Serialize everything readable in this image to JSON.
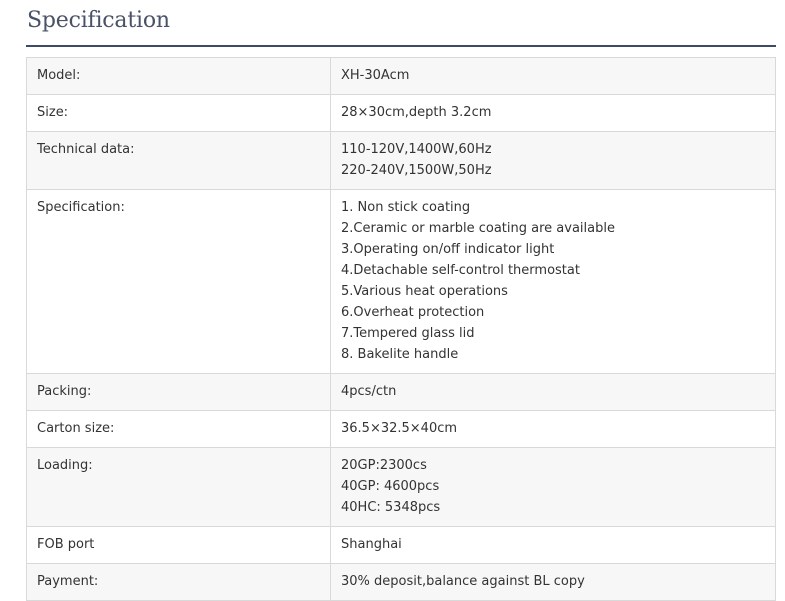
{
  "heading": "Specification",
  "rows": [
    {
      "label": "Model:",
      "lines": [
        "XH-30Acm"
      ]
    },
    {
      "label": "Size:",
      "lines": [
        "28×30cm,depth 3.2cm"
      ]
    },
    {
      "label": "Technical data:",
      "lines": [
        "110-120V,1400W,60Hz",
        "220-240V,1500W,50Hz"
      ]
    },
    {
      "label": "Specification:",
      "lines": [
        "1. Non stick coating",
        "2.Ceramic or marble coating are available",
        "3.Operating on/off indicator light",
        "4.Detachable self-control thermostat",
        "5.Various heat operations",
        "6.Overheat protection",
        "7.Tempered glass lid",
        "8. Bakelite handle"
      ]
    },
    {
      "label": "Packing:",
      "lines": [
        "4pcs/ctn"
      ]
    },
    {
      "label": "Carton size:",
      "lines": [
        "36.5×32.5×40cm"
      ]
    },
    {
      "label": "Loading:",
      "lines": [
        "20GP:2300cs",
        "40GP: 4600pcs",
        "40HC: 5348pcs"
      ]
    },
    {
      "label": "FOB port",
      "lines": [
        "Shanghai"
      ]
    },
    {
      "label": "Payment:",
      "lines": [
        "30% deposit,balance against BL copy"
      ]
    }
  ]
}
